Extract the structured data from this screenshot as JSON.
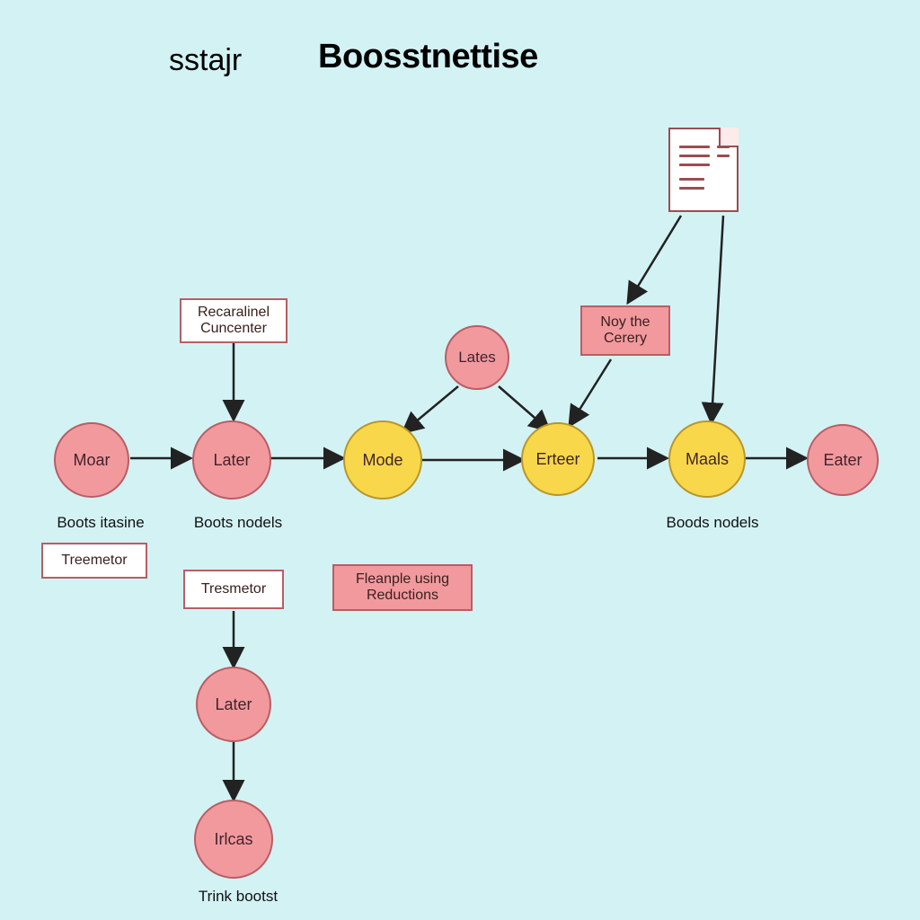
{
  "title": {
    "small": "sstajr",
    "big": "Boosstnettise"
  },
  "nodes": {
    "moar": {
      "label": "Moar"
    },
    "later": {
      "label": "Later"
    },
    "mode": {
      "label": "Mode"
    },
    "erteer": {
      "label": "Erteer"
    },
    "maals": {
      "label": "Maals"
    },
    "eater": {
      "label": "Eater"
    },
    "lates": {
      "label": "Lates"
    },
    "later2": {
      "label": "Later"
    },
    "irlcas": {
      "label": "Irlcas"
    }
  },
  "boxes": {
    "recaralinel": {
      "label": "Recaralinel Cuncenter"
    },
    "noy": {
      "label": "Noy the Cerery"
    },
    "treemetor": {
      "label": "Treemetor"
    },
    "tresmetor": {
      "label": "Tresmetor"
    },
    "fleanple": {
      "label": "Fleanple using Reductions"
    }
  },
  "captions": {
    "boots_itasine": "Boots itasine",
    "boots_nodels": "Boots nodels",
    "boods_nodels": "Boods nodels",
    "trink_bootst": "Trink bootst"
  },
  "icon": {
    "document": "document-icon"
  }
}
